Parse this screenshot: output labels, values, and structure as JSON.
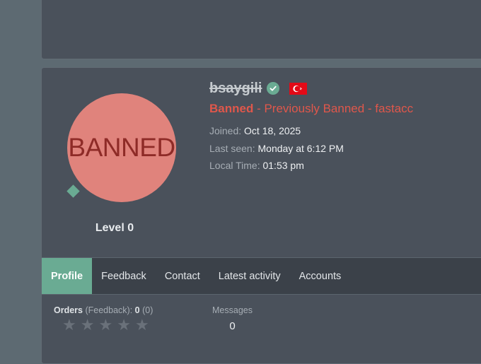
{
  "profile": {
    "avatar_text": "BANNED",
    "level": "Level 0",
    "username": "bsaygili",
    "flag_icon": "turkey-flag-icon",
    "status_banned": "Banned",
    "status_rest": " - Previously Banned - fastacc",
    "joined_label": "Joined:",
    "joined_value": "Oct 18, 2025",
    "last_seen_label": "Last seen:",
    "last_seen_value": "Monday at 6:12 PM",
    "local_time_label": "Local Time:",
    "local_time_value": "01:53 pm"
  },
  "tabs": [
    {
      "label": "Profile"
    },
    {
      "label": "Feedback"
    },
    {
      "label": "Contact"
    },
    {
      "label": "Latest activity"
    },
    {
      "label": "Accounts"
    }
  ],
  "stats": {
    "orders_label": "Orders",
    "feedback_label": "(Feedback):",
    "orders_value": "0",
    "feedback_value": "(0)",
    "rating_stars": 0,
    "rating_max": 5,
    "messages_label": "Messages",
    "messages_value": "0"
  },
  "colors": {
    "accent": "#6aab93",
    "banned": "#e0574b",
    "avatar_bg": "#e0837c",
    "flag": "#e30a17"
  }
}
